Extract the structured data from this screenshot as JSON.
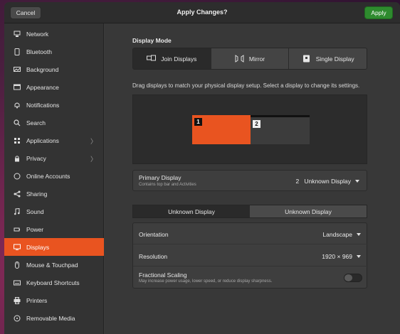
{
  "titlebar": {
    "cancel_label": "Cancel",
    "title": "Apply Changes?",
    "apply_label": "Apply"
  },
  "sidebar": {
    "items": [
      {
        "label": "Network",
        "icon": "network-icon"
      },
      {
        "label": "Bluetooth",
        "icon": "bluetooth-icon"
      },
      {
        "label": "Background",
        "icon": "background-icon"
      },
      {
        "label": "Appearance",
        "icon": "appearance-icon"
      },
      {
        "label": "Notifications",
        "icon": "bell-icon"
      },
      {
        "label": "Search",
        "icon": "search-icon"
      },
      {
        "label": "Applications",
        "icon": "applications-icon",
        "has_submenu": true
      },
      {
        "label": "Privacy",
        "icon": "privacy-icon",
        "has_submenu": true
      },
      {
        "label": "Online Accounts",
        "icon": "cloud-icon"
      },
      {
        "label": "Sharing",
        "icon": "share-icon"
      },
      {
        "label": "Sound",
        "icon": "music-note-icon"
      },
      {
        "label": "Power",
        "icon": "power-icon"
      },
      {
        "label": "Displays",
        "icon": "display-icon",
        "active": true
      },
      {
        "label": "Mouse & Touchpad",
        "icon": "mouse-icon"
      },
      {
        "label": "Keyboard Shortcuts",
        "icon": "keyboard-icon"
      },
      {
        "label": "Printers",
        "icon": "printer-icon"
      },
      {
        "label": "Removable Media",
        "icon": "media-icon"
      }
    ]
  },
  "main": {
    "display_mode_label": "Display Mode",
    "modes": [
      {
        "label": "Join Displays",
        "icon": "join-displays-icon",
        "active": true
      },
      {
        "label": "Mirror",
        "icon": "mirror-icon",
        "active": false
      },
      {
        "label": "Single Display",
        "icon": "single-display-icon",
        "active": false
      }
    ],
    "hint": "Drag displays to match your physical display setup. Select a display to change its settings.",
    "monitors": [
      {
        "number": "1"
      },
      {
        "number": "2"
      }
    ],
    "primary": {
      "label": "Primary Display",
      "sublabel": "Contains top bar and Activities",
      "value": "2   Unknown Display"
    },
    "display_tabs": [
      {
        "label": "Unknown Display",
        "active": true
      },
      {
        "label": "Unknown Display",
        "active": false
      }
    ],
    "orientation": {
      "label": "Orientation",
      "value": "Landscape"
    },
    "resolution": {
      "label": "Resolution",
      "value": "1920 × 969"
    },
    "scaling": {
      "label": "Fractional Scaling",
      "sublabel": "May increase power usage, lower speed, or reduce display sharpness.",
      "enabled": false
    }
  },
  "colors": {
    "accent": "#e95420",
    "apply_green": "#2e8b2e"
  }
}
